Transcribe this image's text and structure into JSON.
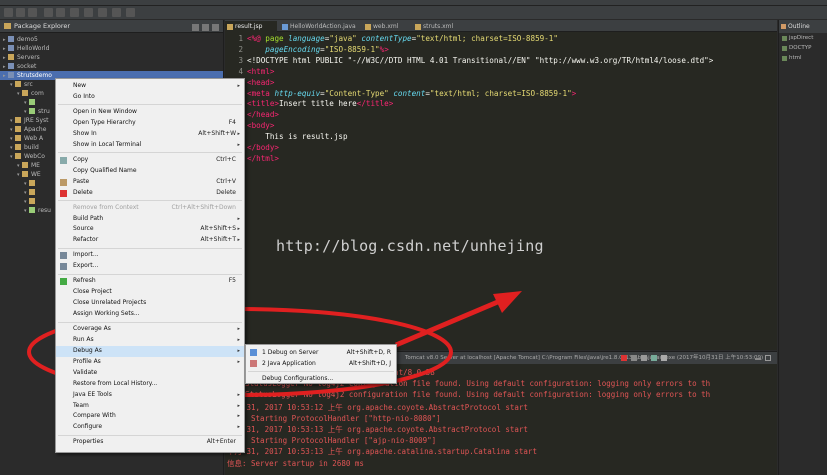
{
  "package_explorer": {
    "title": "Package Explorer",
    "items": [
      {
        "label": "demo5",
        "selected": false
      },
      {
        "label": "HelloWorld",
        "selected": false
      },
      {
        "label": "Servers",
        "selected": false
      },
      {
        "label": "socket",
        "selected": false
      },
      {
        "label": "Strutsdemo",
        "selected": true
      },
      {
        "label": "src",
        "selected": false
      },
      {
        "label": "com",
        "selected": false
      },
      {
        "label": "",
        "selected": false
      },
      {
        "label": "stru",
        "selected": false
      },
      {
        "label": "JRE Syst",
        "selected": false
      },
      {
        "label": "Apache",
        "selected": false
      },
      {
        "label": "Web A",
        "selected": false
      },
      {
        "label": "build",
        "selected": false
      },
      {
        "label": "WebCo",
        "selected": false
      },
      {
        "label": "ME",
        "selected": false
      },
      {
        "label": "WE",
        "selected": false
      },
      {
        "label": "",
        "selected": false
      },
      {
        "label": "",
        "selected": false
      },
      {
        "label": "",
        "selected": false
      },
      {
        "label": "resu",
        "selected": false
      }
    ]
  },
  "editor": {
    "tabs": [
      "result.jsp",
      "HelloWorldAction.java",
      "web.xml",
      "struts.xml"
    ],
    "active_tab": "result.jsp",
    "line_numbers": [
      "1",
      "2",
      "3",
      "4",
      "5",
      "6",
      "7",
      "8",
      "9",
      "10",
      "11",
      "12",
      "13"
    ],
    "code_lines": [
      [
        "k:<%@ ",
        "a:page ",
        "i:language",
        "t:=",
        "s:\"java\"",
        "t: ",
        "i:contentType",
        "t:=",
        "s:\"text/html; charset=ISO-8859-1\""
      ],
      [
        "t:    ",
        "i:pageEncoding",
        "t:=",
        "s:\"ISO-8859-1\"",
        "k:%>"
      ],
      [
        "t:<!DOCTYPE html PUBLIC \"-//W3C//DTD HTML 4.01 Transitional//EN\" \"http://www.w3.org/TR/html4/loose.dtd\">"
      ],
      [
        "k:<html>"
      ],
      [
        "k:<head>"
      ],
      [
        "k:<meta ",
        "i:http-equiv",
        "t:=",
        "s:\"Content-Type\"",
        "t: ",
        "i:content",
        "t:=",
        "s:\"text/html; charset=ISO-8859-1\"",
        "k:>"
      ],
      [
        "k:<title>",
        "t:Insert title here",
        "k:</title>"
      ],
      [
        "k:</head>"
      ],
      [
        "k:<body>"
      ],
      [
        "t:    This is result.jsp"
      ],
      [
        "k:</body>"
      ],
      [
        "k:</html>"
      ],
      [
        "t:"
      ]
    ],
    "watermark": "http://blog.csdn.net/unhejing"
  },
  "outline": {
    "title": "Outline",
    "items": [
      "jspDirect",
      "DOCTYP",
      "html"
    ]
  },
  "console": {
    "header": "Tomcat v8.0 Server at localhost [Apache Tomcat] C:\\Program Files\\Java\\jre1.8.0_131\\bin\\javaw.exe (2017年10月31日 上午10:53:09)",
    "lines": [
      "... INFO: Server version: Apache Tomcat/8.0.38",
      "... StatusLogger No log4j2 configuration file found. Using default configuration: logging only errors to th",
      "... StatusLogger No log4j2 configuration file found. Using default configuration: logging only errors to th",
      "十月 31, 2017 10:53:12 上午 org.apache.coyote.AbstractProtocol start",
      "信息: Starting ProtocolHandler [\"http-nio-8080\"]",
      "十月 31, 2017 10:53:13 上午 org.apache.coyote.AbstractProtocol start",
      "信息: Starting ProtocolHandler [\"ajp-nio-8009\"]",
      "十月 31, 2017 10:53:13 上午 org.apache.catalina.startup.Catalina start",
      "信息: Server startup in 2680 ms"
    ]
  },
  "context_menu": {
    "items": [
      {
        "label": "New",
        "shortcut": "",
        "submenu": true,
        "disabled": false
      },
      {
        "label": "Go Into",
        "shortcut": "",
        "submenu": false,
        "disabled": false
      },
      {
        "sep": true
      },
      {
        "label": "Open in New Window",
        "shortcut": "",
        "submenu": false,
        "disabled": false
      },
      {
        "label": "Open Type Hierarchy",
        "shortcut": "F4",
        "submenu": false,
        "disabled": false
      },
      {
        "label": "Show In",
        "shortcut": "Alt+Shift+W",
        "submenu": true,
        "disabled": false
      },
      {
        "label": "Show in Local Terminal",
        "shortcut": "",
        "submenu": true,
        "disabled": false
      },
      {
        "sep": true
      },
      {
        "label": "Copy",
        "shortcut": "Ctrl+C",
        "submenu": false,
        "disabled": false,
        "icon": "copy"
      },
      {
        "label": "Copy Qualified Name",
        "shortcut": "",
        "submenu": false,
        "disabled": false
      },
      {
        "label": "Paste",
        "shortcut": "Ctrl+V",
        "submenu": false,
        "disabled": false,
        "icon": "paste"
      },
      {
        "label": "Delete",
        "shortcut": "Delete",
        "submenu": false,
        "disabled": false,
        "icon": "delete"
      },
      {
        "sep": true
      },
      {
        "label": "Remove from Context",
        "shortcut": "Ctrl+Alt+Shift+Down",
        "submenu": false,
        "disabled": true
      },
      {
        "label": "Build Path",
        "shortcut": "",
        "submenu": true,
        "disabled": false
      },
      {
        "label": "Source",
        "shortcut": "Alt+Shift+S",
        "submenu": true,
        "disabled": false
      },
      {
        "label": "Refactor",
        "shortcut": "Alt+Shift+T",
        "submenu": true,
        "disabled": false
      },
      {
        "sep": true
      },
      {
        "label": "Import...",
        "shortcut": "",
        "submenu": false,
        "disabled": false,
        "icon": "import"
      },
      {
        "label": "Export...",
        "shortcut": "",
        "submenu": false,
        "disabled": false,
        "icon": "export"
      },
      {
        "sep": true
      },
      {
        "label": "Refresh",
        "shortcut": "F5",
        "submenu": false,
        "disabled": false,
        "icon": "refresh"
      },
      {
        "label": "Close Project",
        "shortcut": "",
        "submenu": false,
        "disabled": false
      },
      {
        "label": "Close Unrelated Projects",
        "shortcut": "",
        "submenu": false,
        "disabled": false
      },
      {
        "label": "Assign Working Sets...",
        "shortcut": "",
        "submenu": false,
        "disabled": false
      },
      {
        "sep": true
      },
      {
        "label": "Coverage As",
        "shortcut": "",
        "submenu": true,
        "disabled": false
      },
      {
        "label": "Run As",
        "shortcut": "",
        "submenu": true,
        "disabled": false
      },
      {
        "label": "Debug As",
        "shortcut": "",
        "submenu": true,
        "disabled": false,
        "highlighted": true
      },
      {
        "label": "Profile As",
        "shortcut": "",
        "submenu": true,
        "disabled": false
      },
      {
        "label": "Validate",
        "shortcut": "",
        "submenu": false,
        "disabled": false
      },
      {
        "label": "Restore from Local History...",
        "shortcut": "",
        "submenu": false,
        "disabled": false
      },
      {
        "label": "Java EE Tools",
        "shortcut": "",
        "submenu": true,
        "disabled": false
      },
      {
        "label": "Team",
        "shortcut": "",
        "submenu": true,
        "disabled": false
      },
      {
        "label": "Compare With",
        "shortcut": "",
        "submenu": true,
        "disabled": false
      },
      {
        "label": "Configure",
        "shortcut": "",
        "submenu": true,
        "disabled": false
      },
      {
        "sep": true
      },
      {
        "label": "Properties",
        "shortcut": "Alt+Enter",
        "submenu": false,
        "disabled": false
      }
    ]
  },
  "debug_submenu": {
    "items": [
      {
        "label": "1 Debug on Server",
        "shortcut": "Alt+Shift+D, R",
        "icon": "server"
      },
      {
        "label": "2 Java Application",
        "shortcut": "Alt+Shift+D, J",
        "icon": "java-app"
      },
      {
        "sep": true
      },
      {
        "label": "Debug Configurations...",
        "shortcut": ""
      }
    ]
  },
  "colors": {
    "annotation": "#e02020",
    "menu_highlight": "#cde3f7",
    "tree_selection": "#4b6eaf",
    "console_text": "#e05555"
  }
}
